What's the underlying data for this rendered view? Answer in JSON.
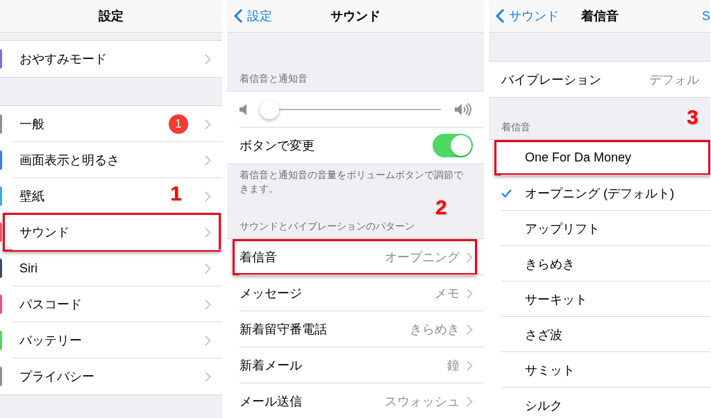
{
  "panels": [
    {
      "nav": {
        "title": "設定"
      },
      "marker": "1",
      "sections": [
        {
          "rows": [
            {
              "kind": "link",
              "label": "おやすみモード",
              "color": "#7d6fd9",
              "chevron": true,
              "highlighted": false
            }
          ]
        },
        {
          "rows": [
            {
              "kind": "link",
              "label": "一般",
              "color": "#8e8e93",
              "badge": "1",
              "chevron": true,
              "highlighted": false
            },
            {
              "kind": "link",
              "label": "画面表示と明るさ",
              "color": "#2f7cf6",
              "chevron": true,
              "highlighted": false
            },
            {
              "kind": "link",
              "label": "壁紙",
              "color": "#35aadc",
              "chevron": true,
              "highlighted": false
            },
            {
              "kind": "link",
              "label": "サウンド",
              "color": "#f0506e",
              "chevron": true,
              "highlighted": true
            },
            {
              "kind": "link",
              "label": "Siri",
              "color": "#3a4a6b",
              "chevron": true,
              "highlighted": false
            },
            {
              "kind": "link",
              "label": "パスコード",
              "color": "#f0506e",
              "chevron": true,
              "highlighted": false
            },
            {
              "kind": "link",
              "label": "バッテリー",
              "color": "#4cd964",
              "chevron": true,
              "highlighted": false
            },
            {
              "kind": "link",
              "label": "プライバシー",
              "color": "#8e8e93",
              "chevron": true,
              "highlighted": false
            }
          ]
        }
      ]
    },
    {
      "nav": {
        "back": "設定",
        "title": "サウンド"
      },
      "marker": "2",
      "sections": [
        {
          "header": "着信音と通知音",
          "footer": "着信音と通知音の音量をボリュームボタンで調節できます。",
          "rows": [
            {
              "kind": "slider",
              "level": 0.05
            },
            {
              "kind": "toggle",
              "label": "ボタンで変更",
              "on": true
            }
          ]
        },
        {
          "header": "サウンドとバイブレーションのパターン",
          "rows": [
            {
              "kind": "link",
              "label": "着信音",
              "value": "オープニング",
              "chevron": true,
              "highlighted": true
            },
            {
              "kind": "link",
              "label": "メッセージ",
              "value": "メモ",
              "chevron": true,
              "highlighted": false
            },
            {
              "kind": "link",
              "label": "新着留守番電話",
              "value": "きらめき",
              "chevron": true,
              "highlighted": false
            },
            {
              "kind": "link",
              "label": "新着メール",
              "value": "鐘",
              "chevron": true,
              "highlighted": false
            },
            {
              "kind": "link",
              "label": "メール送信",
              "value": "スウォッシュ",
              "chevron": true,
              "highlighted": false
            }
          ]
        }
      ]
    },
    {
      "nav": {
        "back": "サウンド",
        "title": "着信音",
        "right": "S"
      },
      "marker": "3",
      "sections": [
        {
          "rows": [
            {
              "kind": "link",
              "label": "バイブレーション",
              "value": "デフォル",
              "chevron": false,
              "highlighted": false
            }
          ]
        },
        {
          "header": "着信音",
          "rows": [
            {
              "kind": "choice",
              "label": "One For Da Money",
              "checked": false,
              "highlighted": true
            },
            {
              "kind": "choice",
              "label": "オープニング (デフォルト)",
              "checked": true,
              "highlighted": false
            },
            {
              "kind": "choice",
              "label": "アップリフト",
              "checked": false,
              "highlighted": false
            },
            {
              "kind": "choice",
              "label": "きらめき",
              "checked": false,
              "highlighted": false
            },
            {
              "kind": "choice",
              "label": "サーキット",
              "checked": false,
              "highlighted": false
            },
            {
              "kind": "choice",
              "label": "さざ波",
              "checked": false,
              "highlighted": false
            },
            {
              "kind": "choice",
              "label": "サミット",
              "checked": false,
              "highlighted": false
            },
            {
              "kind": "choice",
              "label": "シルク",
              "checked": false,
              "highlighted": false
            }
          ]
        }
      ]
    }
  ]
}
